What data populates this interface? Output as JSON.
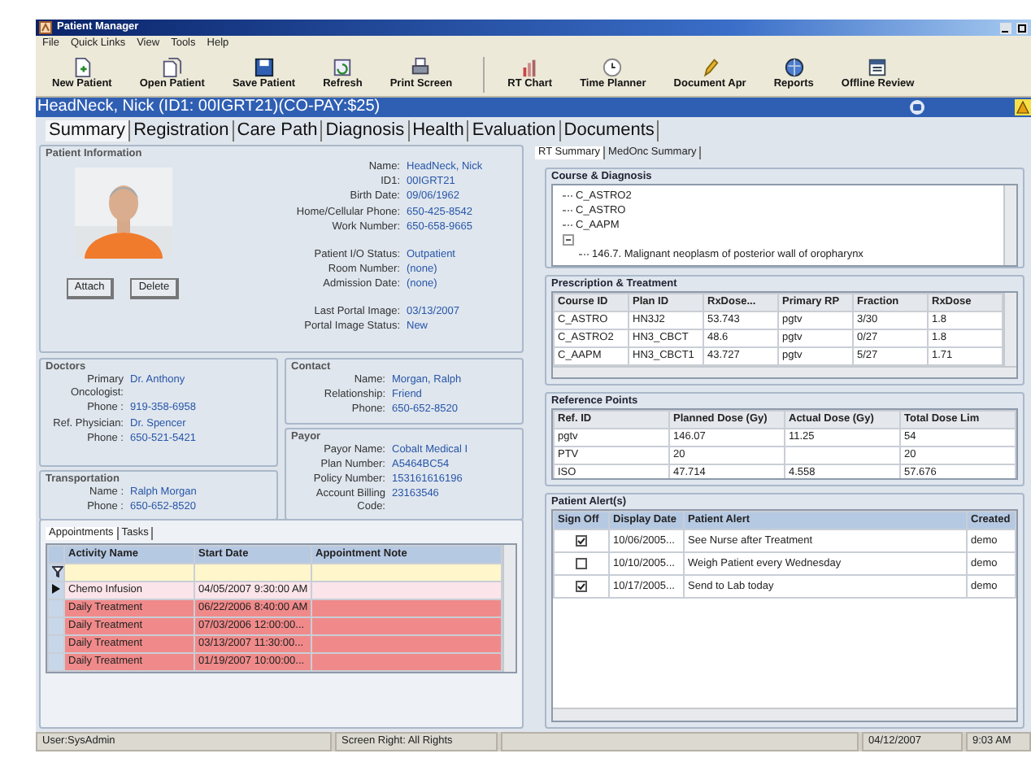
{
  "window": {
    "title": "Patient Manager"
  },
  "menu": [
    "File",
    "Quick Links",
    "View",
    "Tools",
    "Help"
  ],
  "toolbar": [
    {
      "label": "New Patient"
    },
    {
      "label": "Open Patient"
    },
    {
      "label": "Save Patient"
    },
    {
      "label": "Refresh"
    },
    {
      "label": "Print Screen"
    },
    {
      "label": "RT Chart"
    },
    {
      "label": "Time Planner"
    },
    {
      "label": "Document Apr"
    },
    {
      "label": "Reports"
    },
    {
      "label": "Offline Review"
    }
  ],
  "patient_banner": "HeadNeck, Nick (ID1: 00IGRT21)(CO-PAY:$25)",
  "tabs": [
    {
      "label": "Summary",
      "selected": true
    },
    {
      "label": "Registration",
      "selected": false
    },
    {
      "label": "Care Path",
      "selected": false
    },
    {
      "label": "Diagnosis",
      "selected": false
    },
    {
      "label": "Health",
      "selected": false
    },
    {
      "label": "Evaluation",
      "selected": false
    },
    {
      "label": "Documents",
      "selected": false
    }
  ],
  "patient_information": {
    "title": "Patient Information",
    "buttons": [
      "Attach",
      "Delete"
    ],
    "groups": [
      [
        {
          "label": "Name:",
          "value": "HeadNeck, Nick"
        },
        {
          "label": "ID1:",
          "value": "00IGRT21"
        },
        {
          "label": "Birth Date:",
          "value": "09/06/1962"
        },
        {
          "label": "Home/Cellular Phone:",
          "value": "650-425-8542"
        },
        {
          "label": "Work Number:",
          "value": "650-658-9665"
        }
      ],
      [
        {
          "label": "Patient I/O Status:",
          "value": "Outpatient"
        },
        {
          "label": "Room Number:",
          "value": "(none)"
        },
        {
          "label": "Admission Date:",
          "value": "(none)"
        }
      ],
      [
        {
          "label": "Last Portal Image:",
          "value": "03/13/2007"
        },
        {
          "label": "Portal Image Status:",
          "value": "New"
        }
      ]
    ]
  },
  "doctors": {
    "title": "Doctors",
    "fields": [
      {
        "label": "Primary Oncologist:",
        "value": "Dr. Anthony"
      },
      {
        "label": "Phone :",
        "value": "919-358-6958"
      },
      {
        "label": "Ref. Physician:",
        "value": "Dr. Spencer"
      },
      {
        "label": "Phone :",
        "value": "650-521-5421"
      }
    ]
  },
  "transportation": {
    "title": "Transportation",
    "fields": [
      {
        "label": "Name :",
        "value": "Ralph Morgan"
      },
      {
        "label": "Phone :",
        "value": "650-652-8520"
      }
    ]
  },
  "contact": {
    "title": "Contact",
    "fields": [
      {
        "label": "Name:",
        "value": "Morgan, Ralph"
      },
      {
        "label": "Relationship:",
        "value": "Friend"
      },
      {
        "label": "Phone:",
        "value": "650-652-8520"
      }
    ]
  },
  "payor": {
    "title": "Payor",
    "fields": [
      {
        "label": "Payor Name:",
        "value": "Cobalt Medical I"
      },
      {
        "label": "Plan Number:",
        "value": "A5464BC54"
      },
      {
        "label": "Policy Number:",
        "value": "153161616196"
      },
      {
        "label": "Account Billing Code:",
        "value": "23163546"
      }
    ]
  },
  "appointments": {
    "tabs": [
      {
        "label": "Appointments",
        "selected": true
      },
      {
        "label": "Tasks",
        "selected": false
      }
    ],
    "columns": [
      "Activity Name",
      "Start Date",
      "Appointment Note"
    ],
    "rows": [
      {
        "activity": "Chemo Infusion",
        "start_date": "04/05/2007 9:30:00 AM",
        "selected": true,
        "color": "#fbe4ea"
      },
      {
        "activity": "Daily Treatment",
        "start_date": "06/22/2006 8:40:00 AM",
        "selected": false,
        "color": "#f08a8a"
      },
      {
        "activity": "Daily Treatment",
        "start_date": "07/03/2006 12:00:00...",
        "selected": false,
        "color": "#f08a8a"
      },
      {
        "activity": "Daily Treatment",
        "start_date": "03/13/2007 11:30:00...",
        "selected": false,
        "color": "#f08a8a"
      },
      {
        "activity": "Daily Treatment",
        "start_date": "01/19/2007 10:00:00...",
        "selected": false,
        "color": "#f08a8a"
      }
    ]
  },
  "rt_tabs": [
    {
      "label": "RT Summary",
      "selected": true
    },
    {
      "label": "MedOnc Summary",
      "selected": false
    }
  ],
  "course_diagnosis": {
    "title": "Course & Diagnosis",
    "items": [
      {
        "label": "C_ASTRO2"
      },
      {
        "label": "C_ASTRO"
      },
      {
        "label": "C_AAPM"
      },
      {
        "expanded": true,
        "children": [
          {
            "label": "146.7. Malignant neoplasm of posterior wall of oropharynx"
          }
        ]
      }
    ]
  },
  "prescription": {
    "title": "Prescription & Treatment",
    "columns": [
      "Course ID",
      "Plan ID",
      "RxDose...",
      "Primary RP",
      "Fraction",
      "RxDose"
    ],
    "rows": [
      [
        "C_ASTRO",
        "HN3J2",
        "53.743",
        "pgtv",
        "3/30",
        "1.8"
      ],
      [
        "C_ASTRO2",
        "HN3_CBCT",
        "48.6",
        "pgtv",
        "0/27",
        "1.8"
      ],
      [
        "C_AAPM",
        "HN3_CBCT1",
        "43.727",
        "pgtv",
        "5/27",
        "1.71"
      ]
    ]
  },
  "reference_points": {
    "title": "Reference Points",
    "columns": [
      "Ref. ID",
      "Planned Dose (Gy)",
      "Actual Dose (Gy)",
      "Total Dose Lim"
    ],
    "rows": [
      [
        "pgtv",
        "146.07",
        "11.25",
        "54"
      ],
      [
        "PTV",
        "20",
        "",
        "20"
      ],
      [
        "ISO",
        "47.714",
        "4.558",
        "57.676"
      ]
    ]
  },
  "patient_alerts": {
    "title": "Patient Alert(s)",
    "columns": [
      "Sign Off",
      "Display Date",
      "Patient Alert",
      "Created"
    ],
    "rows": [
      {
        "signed_off": true,
        "date": "10/06/2005...",
        "alert": "See Nurse after Treatment",
        "created": "demo"
      },
      {
        "signed_off": false,
        "date": "10/10/2005...",
        "alert": "Weigh Patient every Wednesday",
        "created": "demo"
      },
      {
        "signed_off": true,
        "date": "10/17/2005...",
        "alert": "Send to Lab today",
        "created": "demo"
      }
    ]
  },
  "status_bar": {
    "user": "User:SysAdmin",
    "rights": "Screen Right: All Rights",
    "date": "04/12/2007",
    "time": "9:03 AM"
  }
}
